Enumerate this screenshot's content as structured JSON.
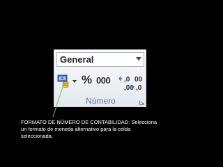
{
  "number_format": {
    "selected": "General"
  },
  "buttons": {
    "accounting_icon": "accounting-number-format-icon",
    "percent_label": "%",
    "comma_label": "000",
    "increase_decimal": {
      "top": ",0",
      "bottom": ",00"
    },
    "decrease_decimal": {
      "top": "00",
      "bottom": ",0"
    }
  },
  "group": {
    "label": "Número"
  },
  "caption": "FORMATO DE NÚMERO DE CONTABILIDAD: Selecciona un formato de moneda alternativo para la celda seleccionada.",
  "colors": {
    "background": "#000000",
    "callout_line": "#7cc242",
    "group_label": "#5d7893"
  }
}
